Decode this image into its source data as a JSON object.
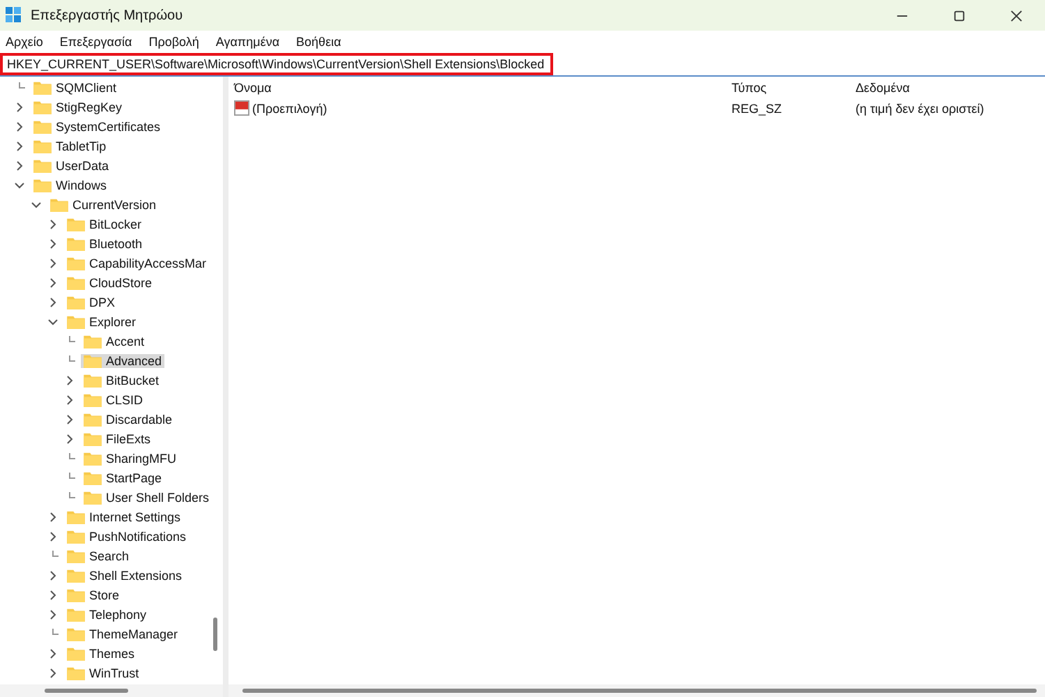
{
  "window": {
    "title": "Επεξεργαστής Μητρώου"
  },
  "menu": [
    "Αρχείο",
    "Επεξεργασία",
    "Προβολή",
    "Αγαπημένα",
    "Βοήθεια"
  ],
  "address": {
    "value": "HKEY_CURRENT_USER\\Software\\Microsoft\\Windows\\CurrentVersion\\Shell Extensions\\Blocked",
    "highlighted": true
  },
  "tree": [
    {
      "label": "SQMClient",
      "expandable": false,
      "expanded": false,
      "selected": false
    },
    {
      "label": "StigRegKey",
      "expandable": true,
      "expanded": false,
      "selected": false
    },
    {
      "label": "SystemCertificates",
      "expandable": true,
      "expanded": false,
      "selected": false
    },
    {
      "label": "TabletTip",
      "expandable": true,
      "expanded": false,
      "selected": false
    },
    {
      "label": "UserData",
      "expandable": true,
      "expanded": false,
      "selected": false
    },
    {
      "label": "Windows",
      "expandable": true,
      "expanded": true,
      "selected": false,
      "children": [
        {
          "label": "CurrentVersion",
          "expandable": true,
          "expanded": true,
          "selected": false,
          "children": [
            {
              "label": "BitLocker",
              "expandable": true,
              "expanded": false,
              "selected": false
            },
            {
              "label": "Bluetooth",
              "expandable": true,
              "expanded": false,
              "selected": false
            },
            {
              "label": "CapabilityAccessMar",
              "expandable": true,
              "expanded": false,
              "selected": false
            },
            {
              "label": "CloudStore",
              "expandable": true,
              "expanded": false,
              "selected": false
            },
            {
              "label": "DPX",
              "expandable": true,
              "expanded": false,
              "selected": false
            },
            {
              "label": "Explorer",
              "expandable": true,
              "expanded": true,
              "selected": false,
              "children": [
                {
                  "label": "Accent",
                  "expandable": false,
                  "expanded": false,
                  "selected": false
                },
                {
                  "label": "Advanced",
                  "expandable": false,
                  "expanded": false,
                  "selected": true
                },
                {
                  "label": "BitBucket",
                  "expandable": true,
                  "expanded": false,
                  "selected": false
                },
                {
                  "label": "CLSID",
                  "expandable": true,
                  "expanded": false,
                  "selected": false
                },
                {
                  "label": "Discardable",
                  "expandable": true,
                  "expanded": false,
                  "selected": false
                },
                {
                  "label": "FileExts",
                  "expandable": true,
                  "expanded": false,
                  "selected": false
                },
                {
                  "label": "SharingMFU",
                  "expandable": false,
                  "expanded": false,
                  "selected": false
                },
                {
                  "label": "StartPage",
                  "expandable": false,
                  "expanded": false,
                  "selected": false
                },
                {
                  "label": "User Shell Folders",
                  "expandable": false,
                  "expanded": false,
                  "selected": false
                }
              ]
            },
            {
              "label": "Internet Settings",
              "expandable": true,
              "expanded": false,
              "selected": false
            },
            {
              "label": "PushNotifications",
              "expandable": true,
              "expanded": false,
              "selected": false
            },
            {
              "label": "Search",
              "expandable": false,
              "expanded": false,
              "selected": false
            },
            {
              "label": "Shell Extensions",
              "expandable": true,
              "expanded": false,
              "selected": false
            },
            {
              "label": "Store",
              "expandable": true,
              "expanded": false,
              "selected": false
            },
            {
              "label": "Telephony",
              "expandable": true,
              "expanded": false,
              "selected": false
            },
            {
              "label": "ThemeManager",
              "expandable": false,
              "expanded": false,
              "selected": false
            },
            {
              "label": "Themes",
              "expandable": true,
              "expanded": false,
              "selected": false
            },
            {
              "label": "WinTrust",
              "expandable": true,
              "expanded": false,
              "selected": false
            }
          ]
        }
      ]
    }
  ],
  "table": {
    "columns": [
      "Όνομα",
      "Τύπος",
      "Δεδομένα"
    ],
    "rows": [
      {
        "name": "(Προεπιλογή)",
        "type": "REG_SZ",
        "data": "(η τιμή δεν έχει οριστεί)"
      }
    ]
  }
}
